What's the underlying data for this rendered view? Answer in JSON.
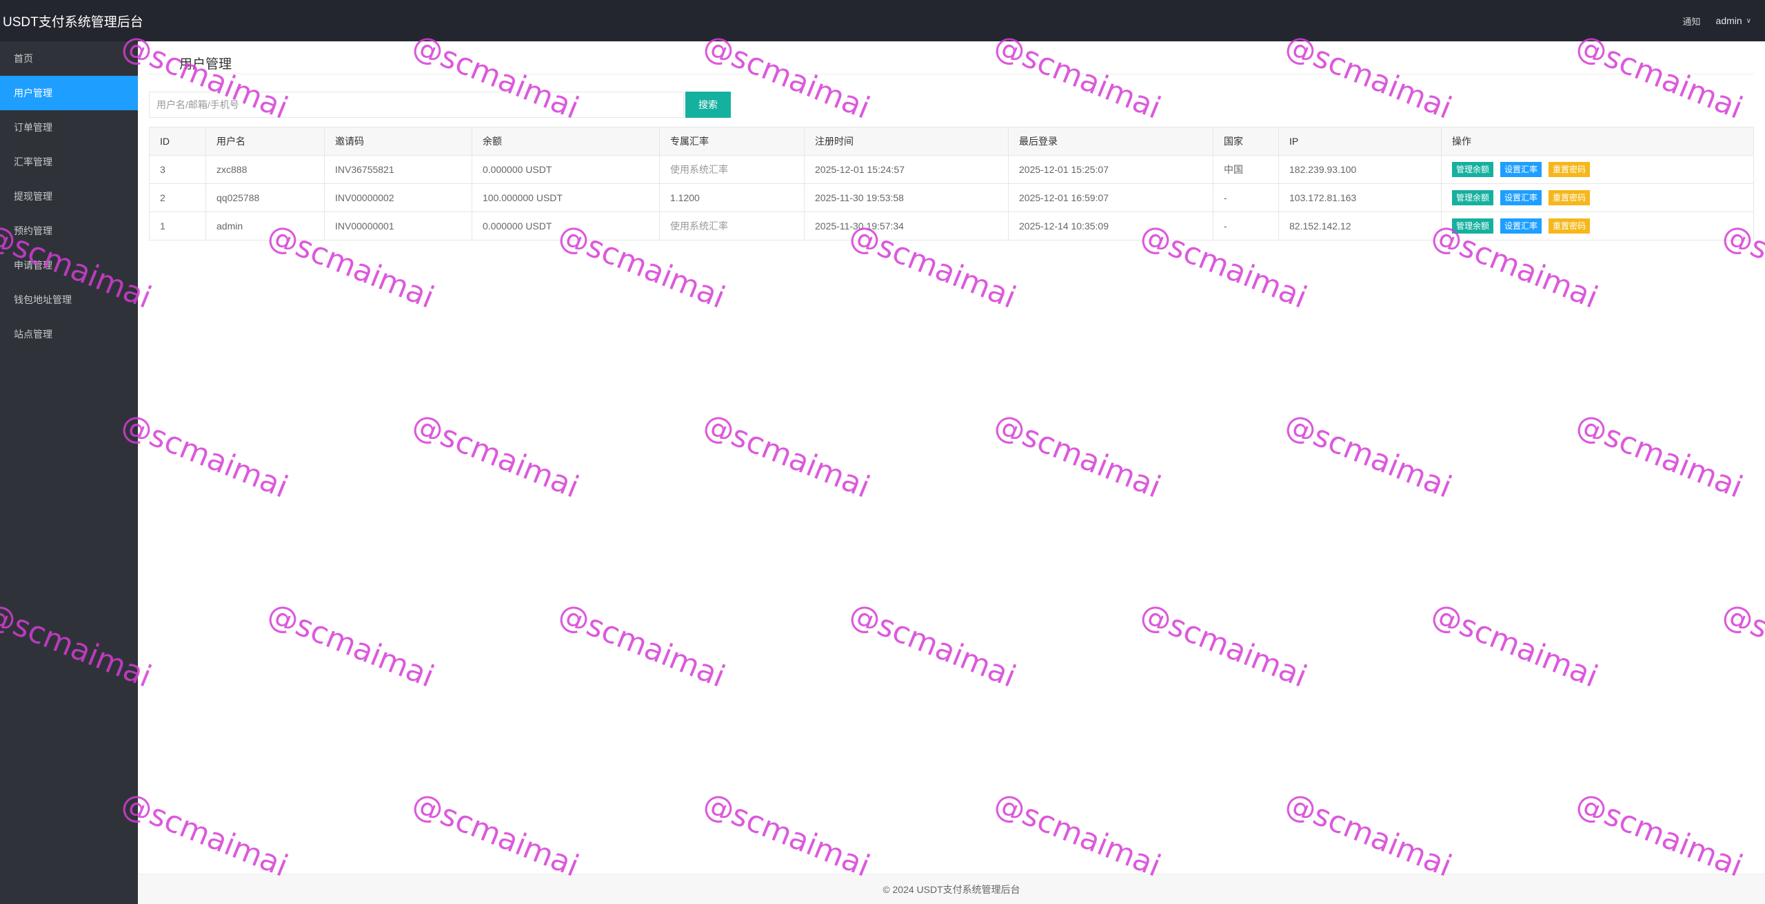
{
  "header": {
    "title": "USDT支付系统管理后台",
    "notice": "通知",
    "username": "admin"
  },
  "sidebar": {
    "items": [
      {
        "label": "首页",
        "active": false
      },
      {
        "label": "用户管理",
        "active": true
      },
      {
        "label": "订单管理",
        "active": false
      },
      {
        "label": "汇率管理",
        "active": false
      },
      {
        "label": "提现管理",
        "active": false
      },
      {
        "label": "预约管理",
        "active": false
      },
      {
        "label": "申请管理",
        "active": false
      },
      {
        "label": "钱包地址管理",
        "active": false
      },
      {
        "label": "站点管理",
        "active": false
      }
    ]
  },
  "main": {
    "title": "用户管理",
    "search": {
      "placeholder": "用户名/邮箱/手机号",
      "value": "",
      "button_label": "搜索"
    },
    "table": {
      "columns": [
        "ID",
        "用户名",
        "邀请码",
        "余额",
        "专属汇率",
        "注册时间",
        "最后登录",
        "国家",
        "IP",
        "操作"
      ],
      "rows": [
        {
          "id": "3",
          "username": "zxc888",
          "invite_code": "INV36755821",
          "balance": "0.000000 USDT",
          "rate": "使用系统汇率",
          "registered": "2025-12-01 15:24:57",
          "last_login": "2025-12-01 15:25:07",
          "country": "中国",
          "ip": "182.239.93.100"
        },
        {
          "id": "2",
          "username": "qq025788",
          "invite_code": "INV00000002",
          "balance": "100.000000 USDT",
          "rate": "1.1200",
          "registered": "2025-11-30 19:53:58",
          "last_login": "2025-12-01 16:59:07",
          "country": "-",
          "ip": "103.172.81.163"
        },
        {
          "id": "1",
          "username": "admin",
          "invite_code": "INV00000001",
          "balance": "0.000000 USDT",
          "rate": "使用系统汇率",
          "registered": "2025-11-30 19:57:34",
          "last_login": "2025-12-14 10:35:09",
          "country": "-",
          "ip": "82.152.142.12"
        }
      ],
      "actions": {
        "manage_balance": "管理余额",
        "set_rate": "设置汇率",
        "reset_password": "重置密码"
      }
    }
  },
  "footer": {
    "text": "© 2024 USDT支付系统管理后台"
  },
  "watermark": {
    "text": "@scmaimai",
    "color": "#d63cd6"
  },
  "colors": {
    "topbar": "#23262e",
    "sidebar": "#2f3339",
    "active": "#1e9fff",
    "green": "#16b09f",
    "orange": "#f5b71b"
  }
}
